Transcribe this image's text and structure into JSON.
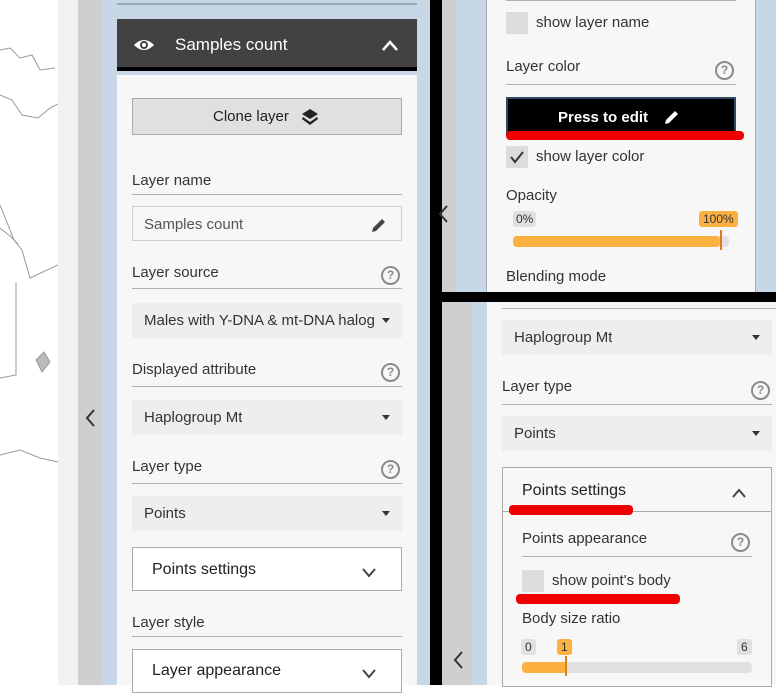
{
  "left_panel": {
    "header_title": "Samples count",
    "clone_button": "Clone layer",
    "layer_name_label": "Layer name",
    "layer_name_value": "Samples count",
    "layer_source_label": "Layer source",
    "layer_source_value": "Males with Y-DNA & mt-DNA halog",
    "displayed_attribute_label": "Displayed attribute",
    "displayed_attribute_value": "Haplogroup Mt",
    "layer_type_label": "Layer type",
    "layer_type_value": "Points",
    "points_settings": "Points settings",
    "layer_style_label": "Layer style",
    "layer_appearance": "Layer appearance"
  },
  "top_right_panel": {
    "show_layer_name": "show layer name",
    "layer_color_label": "Layer color",
    "press_to_edit": "Press to edit",
    "show_layer_color": "show layer color",
    "opacity_label": "Opacity",
    "opacity_min": "0%",
    "opacity_max": "100%",
    "opacity_value": 1.0,
    "blending_mode_label": "Blending mode"
  },
  "bottom_right_panel": {
    "attribute_value": "Haplogroup Mt",
    "layer_type_label": "Layer type",
    "layer_type_value": "Points",
    "points_settings": "Points settings",
    "points_appearance_label": "Points appearance",
    "show_points_body": "show point's body",
    "body_size_ratio_label": "Body size ratio",
    "ratio_min": "0",
    "ratio_value": "1",
    "ratio_max": "6"
  },
  "colors": {
    "header_bg": "#424242",
    "slider_orange": "#fbb040",
    "annotation_red": "#ee0000",
    "panel_blue": "#c8d7e6"
  }
}
